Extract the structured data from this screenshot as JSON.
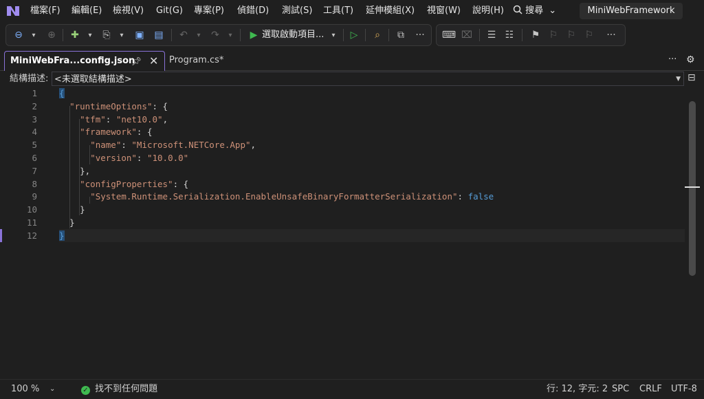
{
  "menubar": {
    "items": [
      "檔案(F)",
      "編輯(E)",
      "檢視(V)",
      "Git(G)",
      "專案(P)",
      "偵錯(D)",
      "測試(S)",
      "工具(T)",
      "延伸模組(X)",
      "視窗(W)",
      "說明(H)"
    ],
    "search_label": "搜尋",
    "project_name": "MiniWebFramework"
  },
  "toolbar": {
    "start_label": "選取啟動項目...",
    "more": "···"
  },
  "tabs": {
    "active": "MiniWebFra...config.json",
    "inactive": "Program.cs*"
  },
  "navbar": {
    "label": "結構描述:",
    "value": "<未選取結構描述>"
  },
  "editor": {
    "line_numbers": [
      "1",
      "2",
      "3",
      "4",
      "5",
      "6",
      "7",
      "8",
      "9",
      "10",
      "11",
      "12"
    ],
    "lines": [
      [
        "{"
      ],
      [
        "  \"runtimeOptions\": {"
      ],
      [
        "    \"tfm\": \"net10.0\","
      ],
      [
        "    \"framework\": {"
      ],
      [
        "      \"name\": \"Microsoft.NETCore.App\","
      ],
      [
        "      \"version\": \"10.0.0\""
      ],
      [
        "    },"
      ],
      [
        "    \"configProperties\": {"
      ],
      [
        "      \"System.Runtime.Serialization.EnableUnsafeBinaryFormatterSerialization\": false"
      ],
      [
        "    }"
      ],
      [
        "  }"
      ],
      [
        "}"
      ]
    ]
  },
  "statusbar": {
    "zoom": "100 %",
    "issues": "找不到任何問題",
    "position": "行: 12, 字元: 2",
    "spaces": "SPC",
    "line_ending": "CRLF",
    "encoding": "UTF-8"
  },
  "colors": {
    "accent": "#8a73d8",
    "string": "#ce9178",
    "keyword": "#569cd6",
    "ok": "#3fb950"
  }
}
